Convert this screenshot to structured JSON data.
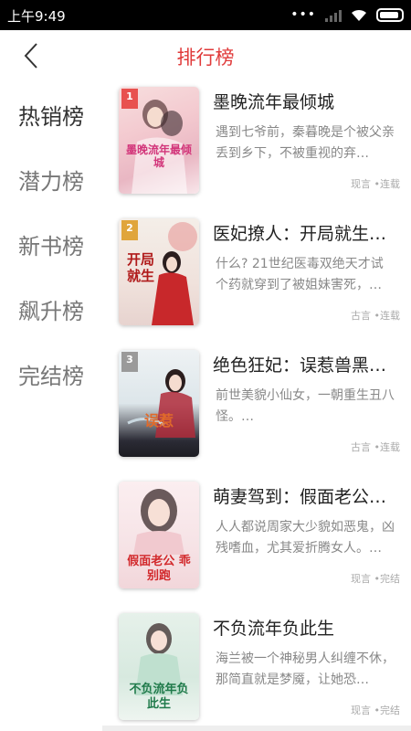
{
  "status_bar": {
    "time": "上午9:49",
    "dots": "•••"
  },
  "header": {
    "title": "排行榜"
  },
  "sidebar": {
    "items": [
      {
        "label": "热销榜"
      },
      {
        "label": "潜力榜"
      },
      {
        "label": "新书榜"
      },
      {
        "label": "飙升榜"
      },
      {
        "label": "完结榜"
      }
    ]
  },
  "books": [
    {
      "rank": "1",
      "title": "墨晚流年最倾城",
      "desc": "遇到七爷前，秦暮晚是个被父亲丢到乡下，不被重视的弃…",
      "genre": "现言",
      "sep": "•",
      "status": "连载",
      "cover_text": "墨晚流年最倾城"
    },
    {
      "rank": "2",
      "title": "医妃撩人：开局就生…",
      "desc": "什么? 21世纪医毒双绝天才试个药就穿到了被姐妹害死，…",
      "genre": "古言",
      "sep": "•",
      "status": "连载",
      "cover_text": "开局就生"
    },
    {
      "rank": "3",
      "title": "绝色狂妃：误惹兽黑…",
      "desc": "前世美貌小仙女，一朝重生丑八怪。…",
      "genre": "古言",
      "sep": "•",
      "status": "连载",
      "cover_text": "误惹"
    },
    {
      "rank": "",
      "title": "萌妻驾到：假面老公…",
      "desc": "人人都说周家大少貌如恶鬼，凶残嗜血，尤其爱折腾女人。…",
      "genre": "现言",
      "sep": "•",
      "status": "完结",
      "cover_text": "假面老公 乖别跑"
    },
    {
      "rank": "",
      "title": "不负流年负此生",
      "desc": "海兰被一个神秘男人纠缠不休，那简直就是梦魇，让她恐…",
      "genre": "现言",
      "sep": "•",
      "status": "完结",
      "cover_text": "不负流年负此生"
    }
  ],
  "colors": {
    "accent": "#e03a3a",
    "rank1": "#e8514f",
    "rank2": "#e0a53c",
    "rank3": "#9a9a9a"
  }
}
